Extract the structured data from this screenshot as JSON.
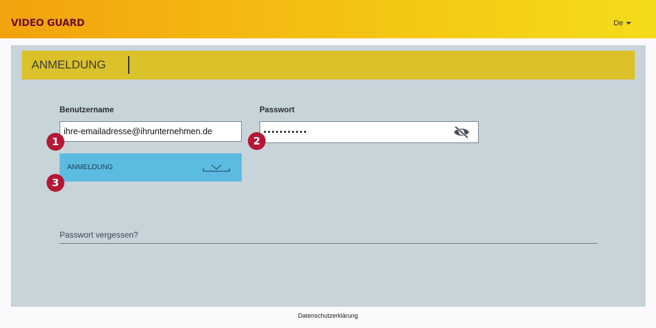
{
  "topbar": {
    "logo": "VIDEO GUARD",
    "language": "De",
    "brand_color": "#f4be12"
  },
  "login": {
    "section_title": "ANMELDUNG",
    "username_label": "Benutzername",
    "username_value": "ihre-emailadresse@ihrunternehmen.de",
    "password_label": "Passwort",
    "password_value": "•••••••••••",
    "visibility_icon": "eye-slash-icon",
    "submit_label": "ANMELDUNG",
    "submit_icon": "chevron-down-icon",
    "forgot_link": "Passwort vergessen?"
  },
  "annotations": [
    "1",
    "2",
    "3"
  ],
  "footer": {
    "privacy_link": "Datenschutzerklärung"
  }
}
